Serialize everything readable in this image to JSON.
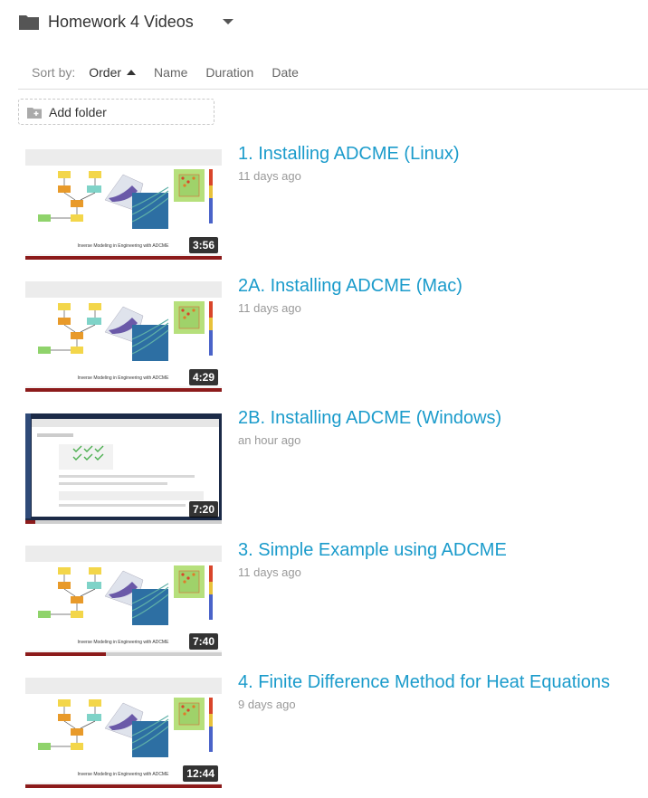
{
  "header": {
    "title": "Homework 4 Videos",
    "folder_icon": "folder-icon",
    "menu_icon": "caret-down-icon"
  },
  "sort": {
    "label": "Sort by:",
    "options": [
      "Order",
      "Name",
      "Duration",
      "Date"
    ],
    "active": "Order",
    "direction": "ascending"
  },
  "add_folder": {
    "label": "Add folder",
    "icon": "add-folder-icon"
  },
  "thumbnail_caption": "Inverse Modeling in Engineering with ADCME",
  "videos": [
    {
      "title": "1. Installing ADCME (Linux)",
      "age": "11 days ago",
      "duration": "3:56",
      "progress": 1.0
    },
    {
      "title": "2A. Installing ADCME (Mac)",
      "age": "11 days ago",
      "duration": "4:29",
      "progress": 1.0
    },
    {
      "title": "2B. Installing ADCME (Windows)",
      "age": "an hour ago",
      "duration": "7:20",
      "progress": 0.05
    },
    {
      "title": "3. Simple Example using ADCME",
      "age": "11 days ago",
      "duration": "7:40",
      "progress": 0.41
    },
    {
      "title": "4. Finite Difference Method for Heat Equations",
      "age": "9 days ago",
      "duration": "12:44",
      "progress": 1.0
    }
  ],
  "colors": {
    "link": "#1a9bcb",
    "progress_fill": "#8c1b1b",
    "progress_track": "#cfcfcf"
  }
}
